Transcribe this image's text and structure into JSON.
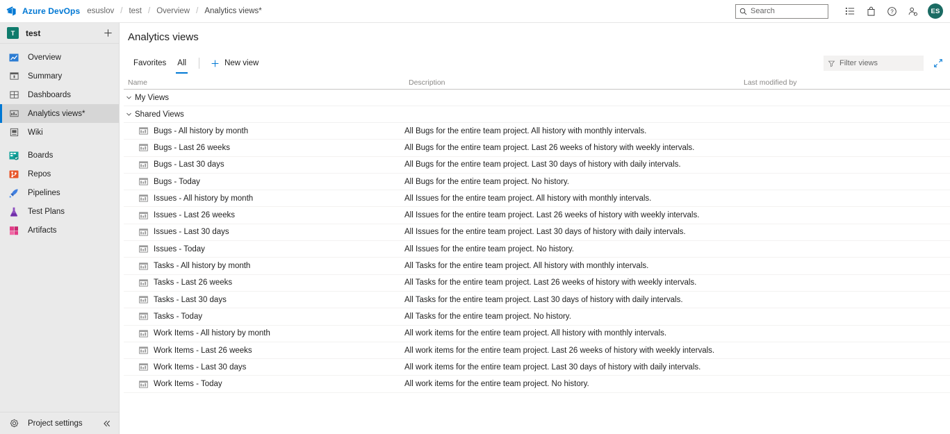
{
  "topbar": {
    "logo_icon": "azure-devops-logo",
    "brand": "Azure DevOps",
    "breadcrumbs": [
      {
        "label": "esuslov"
      },
      {
        "label": "test"
      },
      {
        "label": "Overview"
      },
      {
        "label": "Analytics views*"
      }
    ],
    "separator": "/",
    "search": {
      "placeholder": "Search",
      "icon": "search-icon"
    },
    "icons": [
      {
        "name": "backlog-icon"
      },
      {
        "name": "marketplace-bag-icon"
      },
      {
        "name": "help-icon"
      },
      {
        "name": "user-settings-icon"
      }
    ],
    "avatar": {
      "initials": "ES",
      "color": "#1b6b63"
    }
  },
  "sidebar": {
    "project": {
      "initial": "T",
      "name": "test",
      "avatar_color": "#0f7b6c",
      "add_icon": "plus-icon"
    },
    "items": [
      {
        "label": "Overview",
        "icon": "overview-icon",
        "selected": false,
        "sub": false
      },
      {
        "label": "Summary",
        "icon": "summary-icon",
        "selected": false,
        "sub": true
      },
      {
        "label": "Dashboards",
        "icon": "dashboards-icon",
        "selected": false,
        "sub": true
      },
      {
        "label": "Analytics views*",
        "icon": "analytics-views-icon",
        "selected": true,
        "sub": true
      },
      {
        "label": "Wiki",
        "icon": "wiki-icon",
        "selected": false,
        "sub": true
      },
      {
        "label": "Boards",
        "icon": "boards-icon",
        "selected": false,
        "sub": false
      },
      {
        "label": "Repos",
        "icon": "repos-icon",
        "selected": false,
        "sub": false
      },
      {
        "label": "Pipelines",
        "icon": "pipelines-icon",
        "selected": false,
        "sub": false
      },
      {
        "label": "Test Plans",
        "icon": "test-plans-icon",
        "selected": false,
        "sub": false
      },
      {
        "label": "Artifacts",
        "icon": "artifacts-icon",
        "selected": false,
        "sub": false
      }
    ],
    "footer": {
      "label": "Project settings",
      "icon": "gear-icon",
      "collapse_icon": "chevron-double-left-icon"
    }
  },
  "main": {
    "title": "Analytics views",
    "tabs": [
      {
        "label": "Favorites",
        "active": false
      },
      {
        "label": "All",
        "active": true
      }
    ],
    "new_view": {
      "label": "New view",
      "icon": "plus-icon"
    },
    "filter": {
      "placeholder": "Filter views",
      "icon": "filter-funnel-icon"
    },
    "fullscreen_icon": "expand-diagonal-icon",
    "accent_color": "#0078d4",
    "columns": [
      "Name",
      "Description",
      "Last modified by"
    ],
    "groups": [
      {
        "label": "My Views",
        "expanded": true,
        "rows": []
      },
      {
        "label": "Shared Views",
        "expanded": true,
        "rows": [
          {
            "name": "Bugs - All history by month",
            "description": "All Bugs for the entire team project. All history with monthly intervals.",
            "modified_by": ""
          },
          {
            "name": "Bugs - Last 26 weeks",
            "description": "All Bugs for the entire team project. Last 26 weeks of history with weekly intervals.",
            "modified_by": ""
          },
          {
            "name": "Bugs - Last 30 days",
            "description": "All Bugs for the entire team project. Last 30 days of history with daily intervals.",
            "modified_by": ""
          },
          {
            "name": "Bugs - Today",
            "description": "All Bugs for the entire team project. No history.",
            "modified_by": ""
          },
          {
            "name": "Issues - All history by month",
            "description": "All Issues for the entire team project. All history with monthly intervals.",
            "modified_by": ""
          },
          {
            "name": "Issues - Last 26 weeks",
            "description": "All Issues for the entire team project. Last 26 weeks of history with weekly intervals.",
            "modified_by": ""
          },
          {
            "name": "Issues - Last 30 days",
            "description": "All Issues for the entire team project. Last 30 days of history with daily intervals.",
            "modified_by": ""
          },
          {
            "name": "Issues - Today",
            "description": "All Issues for the entire team project. No history.",
            "modified_by": ""
          },
          {
            "name": "Tasks - All history by month",
            "description": "All Tasks for the entire team project. All history with monthly intervals.",
            "modified_by": ""
          },
          {
            "name": "Tasks - Last 26 weeks",
            "description": "All Tasks for the entire team project. Last 26 weeks of history with weekly intervals.",
            "modified_by": ""
          },
          {
            "name": "Tasks - Last 30 days",
            "description": "All Tasks for the entire team project. Last 30 days of history with daily intervals.",
            "modified_by": ""
          },
          {
            "name": "Tasks - Today",
            "description": "All Tasks for the entire team project. No history.",
            "modified_by": ""
          },
          {
            "name": "Work Items - All history by month",
            "description": "All work items for the entire team project. All history with monthly intervals.",
            "modified_by": ""
          },
          {
            "name": "Work Items - Last 26 weeks",
            "description": "All work items for the entire team project. Last 26 weeks of history with weekly intervals.",
            "modified_by": ""
          },
          {
            "name": "Work Items - Last 30 days",
            "description": "All work items for the entire team project. Last 30 days of history with daily intervals.",
            "modified_by": ""
          },
          {
            "name": "Work Items - Today",
            "description": "All work items for the entire team project. No history.",
            "modified_by": ""
          }
        ]
      }
    ]
  }
}
